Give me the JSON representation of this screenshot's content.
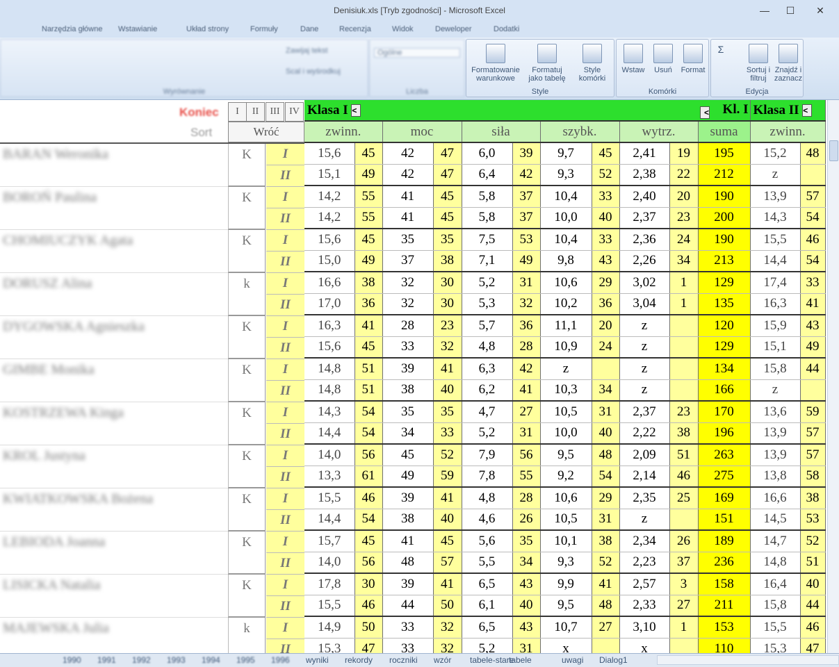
{
  "window": {
    "title": "Denisiuk.xls  [Tryb zgodności] - Microsoft Excel"
  },
  "ribbon_tabs": [
    "Narzędzia główne",
    "Wstawianie",
    "Układ strony",
    "Formuły",
    "Dane",
    "Recenzja",
    "Widok",
    "Deweloper",
    "Dodatki"
  ],
  "ribbon": {
    "wrap_text": "Zawijaj tekst",
    "merge_center": "Scal i wyśrodkuj",
    "align_label": "Wyrównanie",
    "number_format": "Ogólne",
    "number_label": "Liczba",
    "cond_format": "Formatowanie warunkowe",
    "format_table": "Formatuj jako tabelę",
    "cell_styles": "Style komórki",
    "styles_label": "Style",
    "insert": "Wstaw",
    "delete": "Usuń",
    "format": "Format",
    "cells_label": "Komórki",
    "sort_filter": "Sortuj i filtruj",
    "find_select": "Znajdź i zaznacz",
    "editing_label": "Edycja"
  },
  "controls": {
    "koniec": "Koniec",
    "sort": "Sort",
    "wroc": "Wróć",
    "roman": [
      "I",
      "II",
      "III",
      "IV"
    ]
  },
  "header": {
    "klasa1": "Klasa I",
    "kl1": "Kl. I",
    "klasa2": "Klasa II",
    "back_arrow": "<",
    "cols": [
      "zwinn.",
      "moc",
      "siła",
      "szybk.",
      "wytrz.",
      "suma",
      "zwinn."
    ]
  },
  "students": [
    {
      "name": "BARAN Weronika",
      "k": "K",
      "rows": [
        [
          "I",
          "15,6",
          "45",
          "42",
          "47",
          "6,0",
          "39",
          "9,7",
          "45",
          "2,41",
          "19",
          "195",
          "15,2",
          "48"
        ],
        [
          "II",
          "15,1",
          "49",
          "42",
          "47",
          "6,4",
          "42",
          "9,3",
          "52",
          "2,38",
          "22",
          "212",
          "z",
          ""
        ]
      ]
    },
    {
      "name": "BOROŃ Paulina",
      "k": "K",
      "rows": [
        [
          "I",
          "14,2",
          "55",
          "41",
          "45",
          "5,8",
          "37",
          "10,4",
          "33",
          "2,40",
          "20",
          "190",
          "13,9",
          "57"
        ],
        [
          "II",
          "14,2",
          "55",
          "41",
          "45",
          "5,8",
          "37",
          "10,0",
          "40",
          "2,37",
          "23",
          "200",
          "14,3",
          "54"
        ]
      ]
    },
    {
      "name": "CHOMIUCZYK Agata",
      "k": "K",
      "rows": [
        [
          "I",
          "15,6",
          "45",
          "35",
          "35",
          "7,5",
          "53",
          "10,4",
          "33",
          "2,36",
          "24",
          "190",
          "15,5",
          "46"
        ],
        [
          "II",
          "15,0",
          "49",
          "37",
          "38",
          "7,1",
          "49",
          "9,8",
          "43",
          "2,26",
          "34",
          "213",
          "14,4",
          "54"
        ]
      ]
    },
    {
      "name": "DORUSZ Alina",
      "k": "k",
      "rows": [
        [
          "I",
          "16,6",
          "38",
          "32",
          "30",
          "5,2",
          "31",
          "10,6",
          "29",
          "3,02",
          "1",
          "129",
          "17,4",
          "33"
        ],
        [
          "II",
          "17,0",
          "36",
          "32",
          "30",
          "5,3",
          "32",
          "10,2",
          "36",
          "3,04",
          "1",
          "135",
          "16,3",
          "41"
        ]
      ]
    },
    {
      "name": "DYGOWSKA Agnieszka",
      "k": "K",
      "rows": [
        [
          "I",
          "16,3",
          "41",
          "28",
          "23",
          "5,7",
          "36",
          "11,1",
          "20",
          "z",
          "",
          "120",
          "15,9",
          "43"
        ],
        [
          "II",
          "15,6",
          "45",
          "33",
          "32",
          "4,8",
          "28",
          "10,9",
          "24",
          "z",
          "",
          "129",
          "15,1",
          "49"
        ]
      ]
    },
    {
      "name": "GIMBE Monika",
      "k": "K",
      "rows": [
        [
          "I",
          "14,8",
          "51",
          "39",
          "41",
          "6,3",
          "42",
          "z",
          "",
          "z",
          "",
          "134",
          "15,8",
          "44"
        ],
        [
          "II",
          "14,8",
          "51",
          "38",
          "40",
          "6,2",
          "41",
          "10,3",
          "34",
          "z",
          "",
          "166",
          "z",
          ""
        ]
      ]
    },
    {
      "name": "KOSTRZEWA Kinga",
      "k": "K",
      "rows": [
        [
          "I",
          "14,3",
          "54",
          "35",
          "35",
          "4,7",
          "27",
          "10,5",
          "31",
          "2,37",
          "23",
          "170",
          "13,6",
          "59"
        ],
        [
          "II",
          "14,4",
          "54",
          "34",
          "33",
          "5,2",
          "31",
          "10,0",
          "40",
          "2,22",
          "38",
          "196",
          "13,9",
          "57"
        ]
      ]
    },
    {
      "name": "KROL Justyna",
      "k": "K",
      "rows": [
        [
          "I",
          "14,0",
          "56",
          "45",
          "52",
          "7,9",
          "56",
          "9,5",
          "48",
          "2,09",
          "51",
          "263",
          "13,9",
          "57"
        ],
        [
          "II",
          "13,3",
          "61",
          "49",
          "59",
          "7,8",
          "55",
          "9,2",
          "54",
          "2,14",
          "46",
          "275",
          "13,8",
          "58"
        ]
      ]
    },
    {
      "name": "KWIATKOWSKA Bożena",
      "k": "K",
      "rows": [
        [
          "I",
          "15,5",
          "46",
          "39",
          "41",
          "4,8",
          "28",
          "10,6",
          "29",
          "2,35",
          "25",
          "169",
          "16,6",
          "38"
        ],
        [
          "II",
          "14,4",
          "54",
          "38",
          "40",
          "4,6",
          "26",
          "10,5",
          "31",
          "z",
          "",
          "151",
          "14,5",
          "53"
        ]
      ]
    },
    {
      "name": "LEBIODA Joanna",
      "k": "K",
      "rows": [
        [
          "I",
          "15,7",
          "45",
          "41",
          "45",
          "5,6",
          "35",
          "10,1",
          "38",
          "2,34",
          "26",
          "189",
          "14,7",
          "52"
        ],
        [
          "II",
          "14,0",
          "56",
          "48",
          "57",
          "5,5",
          "34",
          "9,3",
          "52",
          "2,23",
          "37",
          "236",
          "14,8",
          "51"
        ]
      ]
    },
    {
      "name": "LISICKA Natalia",
      "k": "K",
      "rows": [
        [
          "I",
          "17,8",
          "30",
          "39",
          "41",
          "6,5",
          "43",
          "9,9",
          "41",
          "2,57",
          "3",
          "158",
          "16,4",
          "40"
        ],
        [
          "II",
          "15,5",
          "46",
          "44",
          "50",
          "6,1",
          "40",
          "9,5",
          "48",
          "2,33",
          "27",
          "211",
          "15,8",
          "44"
        ]
      ]
    },
    {
      "name": "MAJEWSKA Julia",
      "k": "k",
      "rows": [
        [
          "I",
          "14,9",
          "50",
          "33",
          "32",
          "6,5",
          "43",
          "10,7",
          "27",
          "3,10",
          "1",
          "153",
          "15,5",
          "46"
        ],
        [
          "II",
          "15,3",
          "47",
          "33",
          "32",
          "5,2",
          "31",
          "x",
          "",
          "x",
          "",
          "110",
          "15,3",
          "47"
        ]
      ]
    }
  ],
  "sheet_tabs": [
    "1990",
    "1991",
    "1992",
    "1993",
    "1994",
    "1995",
    "1996",
    "wyniki",
    "rekordy",
    "roczniki",
    "wzór",
    "tabele-stare",
    "tabele",
    "uwagi",
    "Dialog1"
  ]
}
